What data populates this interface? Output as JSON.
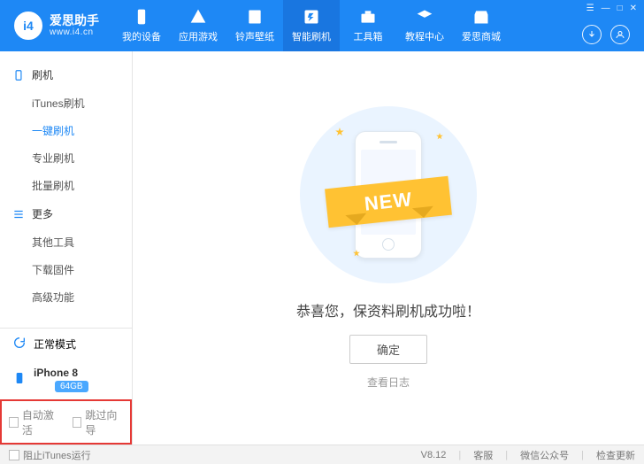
{
  "brand": {
    "title": "爱思助手",
    "sub": "www.i4.cn",
    "logo_text": "i4"
  },
  "nav": {
    "items": [
      {
        "label": "我的设备"
      },
      {
        "label": "应用游戏"
      },
      {
        "label": "铃声壁纸"
      },
      {
        "label": "智能刷机"
      },
      {
        "label": "工具箱"
      },
      {
        "label": "教程中心"
      },
      {
        "label": "爱思商城"
      }
    ],
    "active_index": 3
  },
  "tray": {
    "menu": "☰",
    "min": "—",
    "max": "□",
    "close": "✕"
  },
  "sidebar": {
    "groups": [
      {
        "title": "刷机",
        "items": [
          "iTunes刷机",
          "一键刷机",
          "专业刷机",
          "批量刷机"
        ],
        "active_index": 1
      },
      {
        "title": "更多",
        "items": [
          "其他工具",
          "下载固件",
          "高级功能"
        ],
        "active_index": -1
      }
    ],
    "mode": "正常模式",
    "device": {
      "name": "iPhone 8",
      "storage": "64GB"
    },
    "checks": {
      "auto_activate": "自动激活",
      "skip_guide": "跳过向导"
    }
  },
  "result": {
    "ribbon": "NEW",
    "message": "恭喜您，保资料刷机成功啦！",
    "ok": "确定",
    "log": "查看日志"
  },
  "footer": {
    "block_itunes": "阻止iTunes运行",
    "version": "V8.12",
    "links": [
      "客服",
      "微信公众号",
      "检查更新"
    ]
  }
}
